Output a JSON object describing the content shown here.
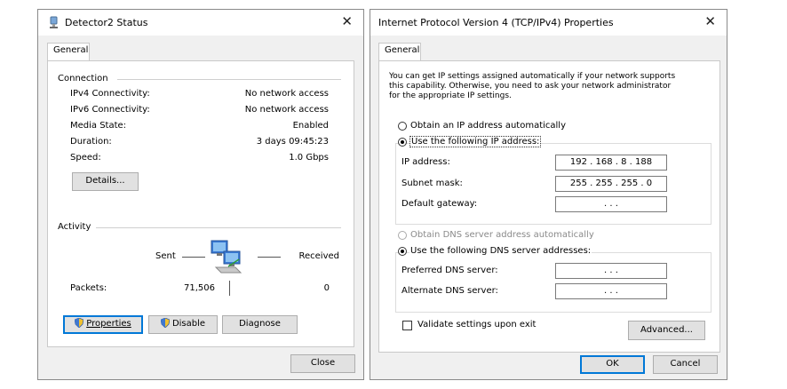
{
  "status_dialog": {
    "title": "Detector2 Status",
    "tab": "General",
    "connection": {
      "heading": "Connection",
      "rows": [
        {
          "label": "IPv4 Connectivity:",
          "value": "No network access"
        },
        {
          "label": "IPv6 Connectivity:",
          "value": "No network access"
        },
        {
          "label": "Media State:",
          "value": "Enabled"
        },
        {
          "label": "Duration:",
          "value": "3 days 09:45:23"
        },
        {
          "label": "Speed:",
          "value": "1.0 Gbps"
        }
      ],
      "details_button": "Details..."
    },
    "activity": {
      "heading": "Activity",
      "sent_label": "Sent",
      "received_label": "Received",
      "packets_label": "Packets:",
      "packets_sent": "71,506",
      "packets_received": "0"
    },
    "buttons": {
      "properties": "Properties",
      "disable": "Disable",
      "diagnose": "Diagnose",
      "close": "Close"
    }
  },
  "ipv4_dialog": {
    "title": "Internet Protocol Version 4 (TCP/IPv4) Properties",
    "tab": "General",
    "description": [
      "You can get IP settings assigned automatically if your network supports",
      "this capability. Otherwise, you need to ask your network administrator",
      "for the appropriate IP settings."
    ],
    "obtain_ip_auto": "Obtain an IP address automatically",
    "use_following_ip": "Use the following IP address:",
    "ip_address_label": "IP address:",
    "ip_address_value": "192 . 168 .  8  . 188",
    "subnet_mask_label": "Subnet mask:",
    "subnet_mask_value": "255 . 255 . 255 .  0",
    "default_gateway_label": "Default gateway:",
    "default_gateway_value": ".       .       .",
    "obtain_dns_auto": "Obtain DNS server address automatically",
    "use_following_dns": "Use the following DNS server addresses:",
    "preferred_dns_label": "Preferred DNS server:",
    "preferred_dns_value": ".       .       .",
    "alternate_dns_label": "Alternate DNS server:",
    "alternate_dns_value": ".       .       .",
    "validate_label": "Validate settings upon exit",
    "advanced_button": "Advanced...",
    "ok_button": "OK",
    "cancel_button": "Cancel"
  }
}
